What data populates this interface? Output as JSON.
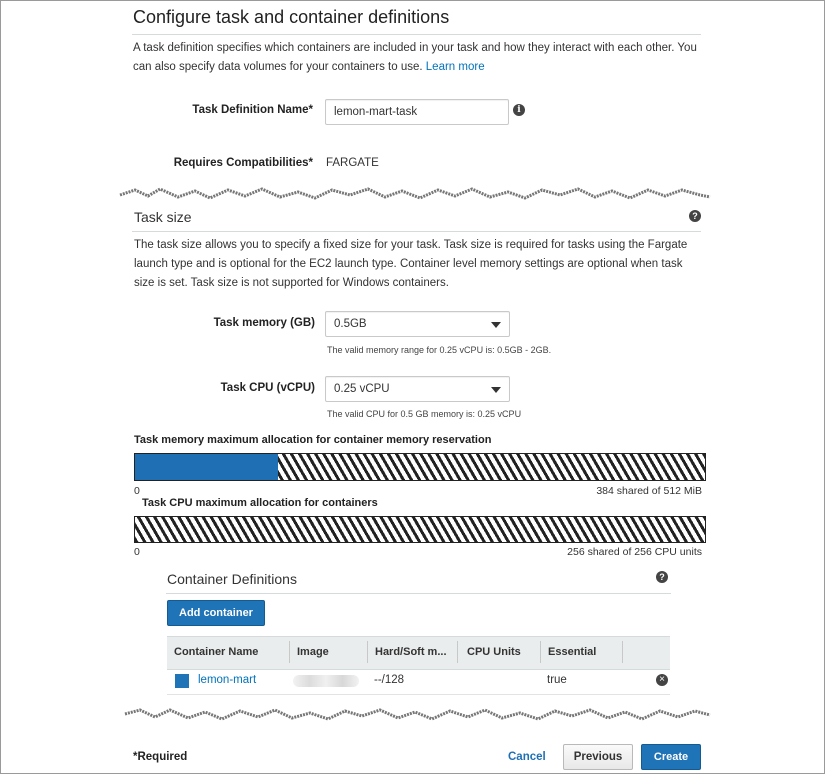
{
  "section": {
    "title": "Configure task and container definitions",
    "description": "A task definition specifies which containers are included in your task and how they interact with each other. You can also specify data volumes for your containers to use.",
    "learn_more": "Learn more",
    "task_definition_name_label": "Task Definition Name*",
    "task_definition_name_value": "lemon-mart-task",
    "requires_compat_label": "Requires Compatibilities*",
    "requires_compat_value": "FARGATE"
  },
  "task_size": {
    "title": "Task size",
    "description": "The task size allows you to specify a fixed size for your task. Task size is required for tasks using the Fargate launch type and is optional for the EC2 launch type. Container level memory settings are optional when task size is set. Task size is not supported for Windows containers.",
    "memory_label": "Task memory (GB)",
    "memory_value": "0.5GB",
    "memory_hint": "The valid memory range for 0.25 vCPU is: 0.5GB - 2GB.",
    "cpu_label": "Task CPU (vCPU)",
    "cpu_value": "0.25 vCPU",
    "cpu_hint": "The valid CPU for 0.5 GB memory is: 0.25 vCPU"
  },
  "allocation": {
    "memory_title": "Task memory maximum allocation for container memory reservation",
    "memory_min": "0",
    "memory_text": "384 shared of 512 MiB",
    "memory_fill_fraction": 0.25,
    "cpu_title": "Task CPU maximum allocation for containers",
    "cpu_min": "0",
    "cpu_text": "256 shared of 256 CPU units",
    "cpu_fill_fraction": 0.0
  },
  "containers": {
    "title": "Container Definitions",
    "add_button": "Add container",
    "columns": [
      "Container Name",
      "Image",
      "Hard/Soft m...",
      "CPU Units",
      "Essential"
    ],
    "rows": [
      {
        "name": "lemon-mart",
        "image": "",
        "memory": "--/128",
        "cpu": "",
        "essential": "true"
      }
    ]
  },
  "footer": {
    "required": "*Required",
    "cancel": "Cancel",
    "previous": "Previous",
    "create": "Create"
  },
  "colors": {
    "accent": "#1f73b7",
    "link": "#0073bb",
    "bar_fill": "#1f6fb5"
  },
  "icons": {
    "name_info": "info-icon",
    "task_size_help": "help-icon",
    "containers_help": "help-icon",
    "row_remove": "close-circle-icon",
    "select_caret": "caret-down-icon"
  }
}
